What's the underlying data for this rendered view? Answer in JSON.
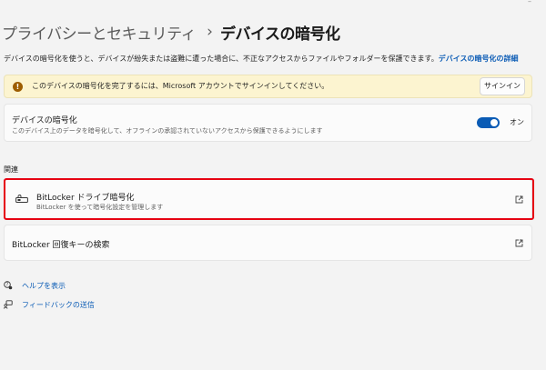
{
  "breadcrumb": {
    "parent": "プライバシーとセキュリティ",
    "separator": "›",
    "current": "デバイスの暗号化"
  },
  "description": {
    "text": "デバイスの暗号化を使うと、デバイスが紛失または盗難に遭った場合に、不正なアクセスからファイルやフォルダーを保護できます。",
    "link": "デバイスの暗号化の詳細"
  },
  "infobar": {
    "message": "このデバイスの暗号化を完了するには、Microsoft アカウントでサインインしてください。",
    "button": "サインイン"
  },
  "encryption": {
    "title": "デバイスの暗号化",
    "subtitle": "このデバイス上のデータを暗号化して、オフラインの承認されていないアクセスから保護できるようにします",
    "toggle_state": "オン"
  },
  "related": {
    "heading": "関連",
    "bitlocker": {
      "title": "BitLocker ドライブ暗号化",
      "subtitle": "BitLocker を使って暗号化設定を管理します"
    },
    "recovery": {
      "title": "BitLocker 回復キーの検索"
    }
  },
  "links": {
    "help": "ヘルプを表示",
    "feedback": "フィードバックの送信"
  },
  "colors": {
    "accent": "#0a5bb5",
    "highlight": "#e60012",
    "warning_bg": "#fcf4d0"
  }
}
